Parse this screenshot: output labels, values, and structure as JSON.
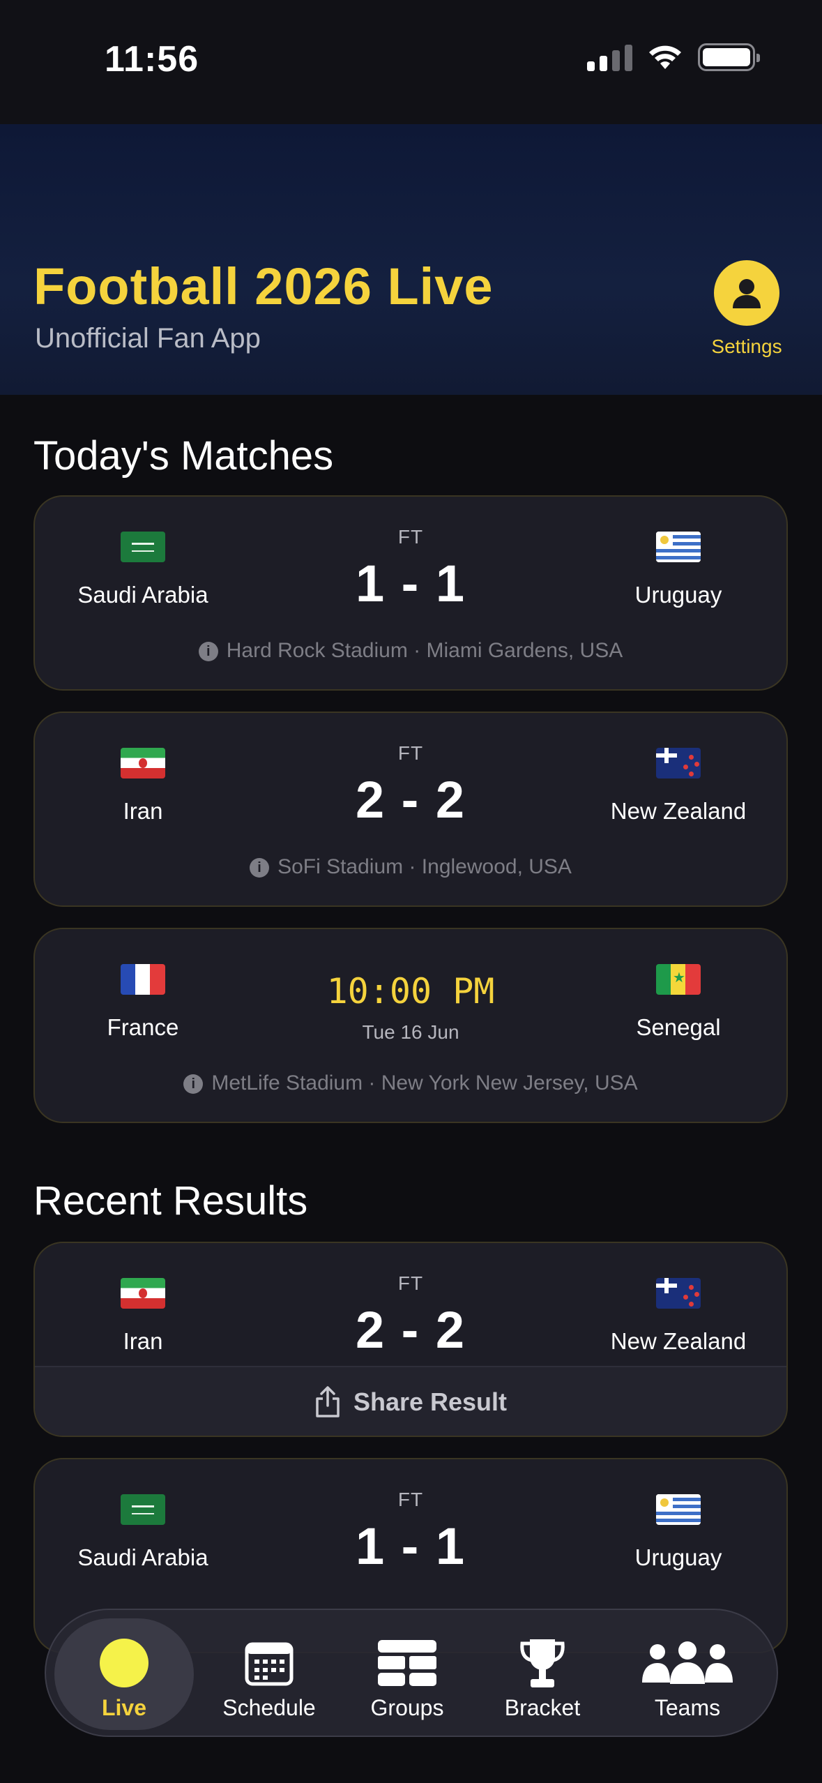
{
  "status_bar": {
    "time": "11:56"
  },
  "header": {
    "title": "Football 2026 Live",
    "subtitle": "Unofficial Fan App",
    "settings_label": "Settings"
  },
  "sections": {
    "today": "Today's Matches",
    "recent": "Recent Results"
  },
  "todays_matches": [
    {
      "home": "Saudi Arabia",
      "away": "Uruguay",
      "status": "FT",
      "score": "1 - 1",
      "venue": "Hard Rock Stadium · Miami Gardens, USA"
    },
    {
      "home": "Iran",
      "away": "New Zealand",
      "status": "FT",
      "score": "2 - 2",
      "venue": "SoFi Stadium · Inglewood, USA"
    },
    {
      "home": "France",
      "away": "Senegal",
      "time": "10:00 PM",
      "date": "Tue 16 Jun",
      "venue": "MetLife Stadium · New York New Jersey, USA"
    }
  ],
  "recent_results": [
    {
      "home": "Iran",
      "away": "New Zealand",
      "status": "FT",
      "score": "2 - 2",
      "share_label": "Share Result"
    },
    {
      "home": "Saudi Arabia",
      "away": "Uruguay",
      "status": "FT",
      "score": "1 - 1"
    }
  ],
  "tabbar": {
    "tabs": [
      {
        "label": "Live",
        "icon": "live-dot-icon",
        "active": true
      },
      {
        "label": "Schedule",
        "icon": "calendar-icon"
      },
      {
        "label": "Groups",
        "icon": "table-grid-icon"
      },
      {
        "label": "Bracket",
        "icon": "trophy-icon"
      },
      {
        "label": "Teams",
        "icon": "people-icon"
      }
    ]
  },
  "colors": {
    "accent": "#f5d33d",
    "background": "#0d0d11",
    "card": "#1d1d26",
    "header": "#14203f"
  }
}
